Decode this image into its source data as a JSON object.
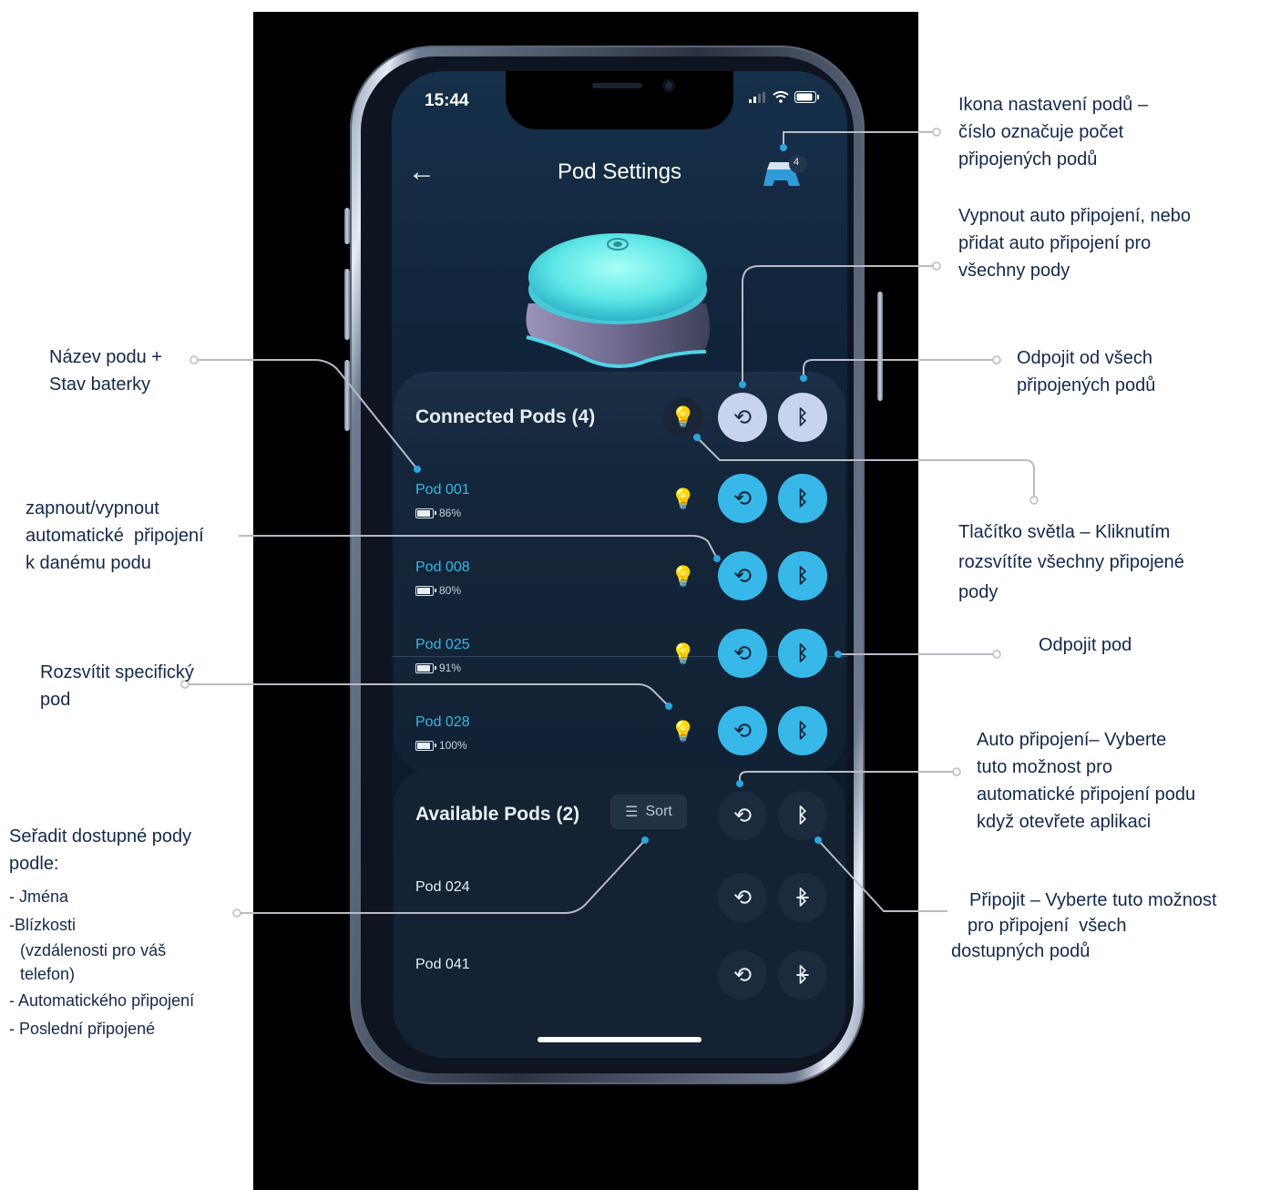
{
  "status_bar": {
    "time": "15:44"
  },
  "header": {
    "back_label": "←",
    "title": "Pod Settings",
    "pods_count": "4"
  },
  "connected": {
    "title": "Connected Pods (4)",
    "pods": [
      {
        "name": "Pod 001",
        "battery": "86%"
      },
      {
        "name": "Pod 008",
        "battery": "80%"
      },
      {
        "name": "Pod 025",
        "battery": "91%"
      },
      {
        "name": "Pod 028",
        "battery": "100%"
      }
    ]
  },
  "available": {
    "title": "Available Pods (2)",
    "sort_label": "Sort",
    "pods": [
      {
        "name": "Pod 024"
      },
      {
        "name": "Pod 041"
      }
    ]
  },
  "annotations": {
    "settings_icon": [
      "Ikona nastavení podů –",
      "číslo označuje počet",
      "připojených podů"
    ],
    "auto_all": [
      "Vypnout auto připojení, nebo",
      "přidat auto připojení pro",
      "všechny pody"
    ],
    "disconnect_all": [
      "Odpojit od všech",
      "připojených podů"
    ],
    "light_button": [
      "Tlačítko světla – Kliknutím",
      "rozsvítíte všechny připojené",
      "pody"
    ],
    "disconnect_pod": [
      "Odpojit pod"
    ],
    "auto_connect": [
      "Auto připojení– Vyberte",
      "tuto možnost pro",
      "automatické připojení podu",
      "když otevřete aplikaci"
    ],
    "connect": [
      "Připojit – Vyberte tuto možnost",
      "pro připojení  všech",
      "dostupných podů"
    ],
    "pod_name": [
      "Název podu +",
      "Stav baterky"
    ],
    "toggle_auto": [
      "zapnout/vypnout",
      "automatické  připojení",
      "k danému podu"
    ],
    "light_pod": [
      "Rozsvítit specifický",
      "pod"
    ],
    "sort": [
      "Seřadit dostupné pody",
      "podle:"
    ],
    "sort_options": [
      "- Jména",
      "-Blízkosti",
      "(vzdálenosti pro váš",
      "telefon)",
      "- Automatického připojení",
      "- Poslední připojené"
    ]
  },
  "colors": {
    "accent": "#38b8e8",
    "annotation_text": "#13294b",
    "connector": "#b8bcc4"
  }
}
